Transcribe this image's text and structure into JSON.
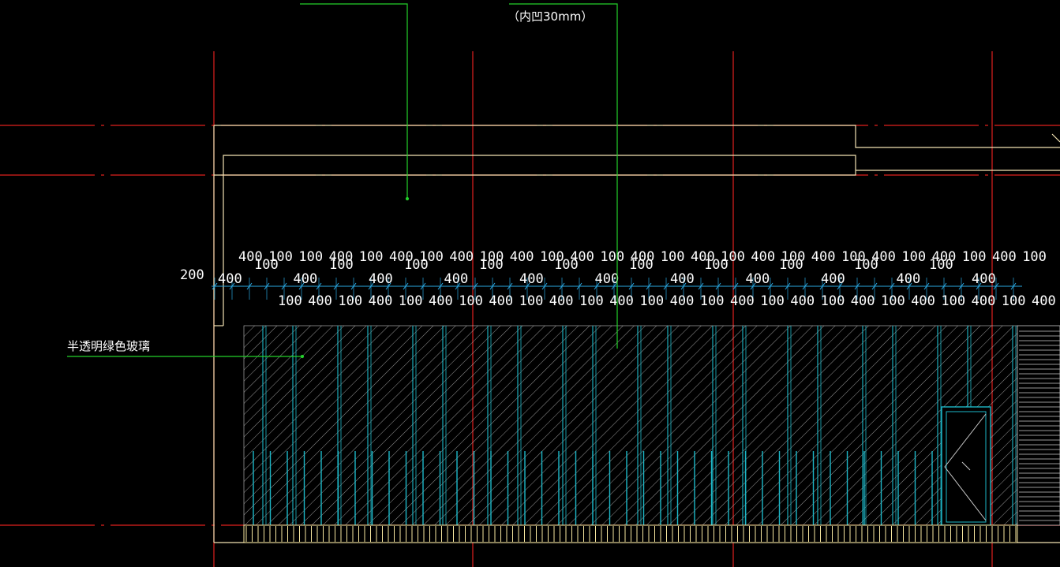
{
  "annotations": {
    "recess_note": "（内凹30mm）",
    "glass_note": "半透明绿色玻璃",
    "edge_dimension": "200"
  },
  "dimensions": {
    "top_row": [
      "400",
      "100",
      "100",
      "400",
      "100",
      "400",
      "100",
      "400",
      "100",
      "400",
      "100",
      "400",
      "100",
      "400",
      "100",
      "400",
      "100",
      "400",
      "100",
      "400",
      "100",
      "400",
      "100",
      "400",
      "100",
      "400",
      "100"
    ],
    "upper_offset_row": [
      "100",
      "100",
      "100",
      "100",
      "100",
      "100",
      "100",
      "100",
      "100",
      "100"
    ],
    "middle_row": [
      "400",
      "400",
      "400",
      "400",
      "400",
      "400",
      "400",
      "400",
      "400",
      "400",
      "400"
    ],
    "bottom_row": [
      "100",
      "400",
      "100",
      "400",
      "100",
      "400",
      "100",
      "400",
      "100",
      "400",
      "100",
      "400",
      "100",
      "400",
      "100",
      "400",
      "100",
      "400",
      "100",
      "400",
      "100",
      "400",
      "100",
      "400",
      "100",
      "400"
    ]
  },
  "colors": {
    "background": "#000000",
    "grid_axis": "#e0201e",
    "outline": "#f2e3b3",
    "leader": "#23d12a",
    "glass_mullion": "#1db8c8",
    "hatch": "#c9c9c9",
    "dimension_tick": "#2aa7e0",
    "base_strip": "#f7e7a0"
  }
}
